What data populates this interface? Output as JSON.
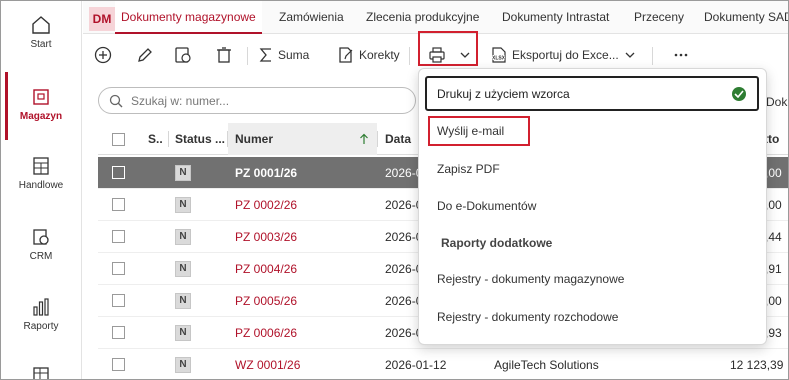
{
  "nav": {
    "items": [
      {
        "label": "Start",
        "icon": "home-icon"
      },
      {
        "label": "Magazyn",
        "icon": "warehouse-icon",
        "active": true
      },
      {
        "label": "Handlowe",
        "icon": "calculator-icon"
      },
      {
        "label": "CRM",
        "icon": "crm-icon"
      },
      {
        "label": "Raporty",
        "icon": "chart-icon"
      },
      {
        "label": "",
        "icon": "grid-icon"
      }
    ]
  },
  "tabs": {
    "badge": "DM",
    "items": [
      "Dokumenty magazynowe",
      "Zamówienia",
      "Zlecenia produkcyjne",
      "Dokumenty Intrastat",
      "Przeceny",
      "Dokumenty SAD"
    ]
  },
  "toolbar": {
    "sum_label": "Suma",
    "corrections_label": "Korekty",
    "export_label": "Eksportuj do Exce..."
  },
  "search": {
    "placeholder": "Szukaj w: numer..."
  },
  "table": {
    "headers": {
      "s": "S..",
      "status": "Status ...",
      "numer": "Numer",
      "data": "Data",
      "brutto": "tto"
    },
    "right_header_fragment": "Dok",
    "rows": [
      {
        "status": "N",
        "numer": "PZ 0001/26",
        "data": "2026-0",
        "kontrahent": "",
        "kwota": ",00",
        "selected": true
      },
      {
        "status": "N",
        "numer": "PZ 0002/26",
        "data": "2026-0",
        "kontrahent": "",
        "kwota": ",00"
      },
      {
        "status": "N",
        "numer": "PZ 0003/26",
        "data": "2026-0",
        "kontrahent": "",
        "kwota": ",44"
      },
      {
        "status": "N",
        "numer": "PZ 0004/26",
        "data": "2026-0",
        "kontrahent": "",
        "kwota": ",91"
      },
      {
        "status": "N",
        "numer": "PZ 0005/26",
        "data": "2026-0",
        "kontrahent": "",
        "kwota": ",00"
      },
      {
        "status": "N",
        "numer": "PZ 0006/26",
        "data": "2026-0",
        "kontrahent": "",
        "kwota": ",93"
      },
      {
        "status": "N",
        "numer": "WZ 0001/26",
        "data": "2026-01-12",
        "kontrahent": "AgileTech Solutions",
        "kwota": "12 123,39"
      }
    ]
  },
  "print_menu": {
    "items": [
      "Drukuj z użyciem wzorca",
      "Wyślij e-mail",
      "Zapisz PDF",
      "Do e-Dokumentów"
    ],
    "section": "Raporty dodatkowe",
    "reports": [
      "Rejestry - dokumenty magazynowe",
      "Rejestry - dokumenty rozchodowe"
    ]
  },
  "colors": {
    "accent": "#b0122a",
    "highlight": "#d2202f",
    "selected_row": "#717171",
    "check": "#2e7d32"
  }
}
